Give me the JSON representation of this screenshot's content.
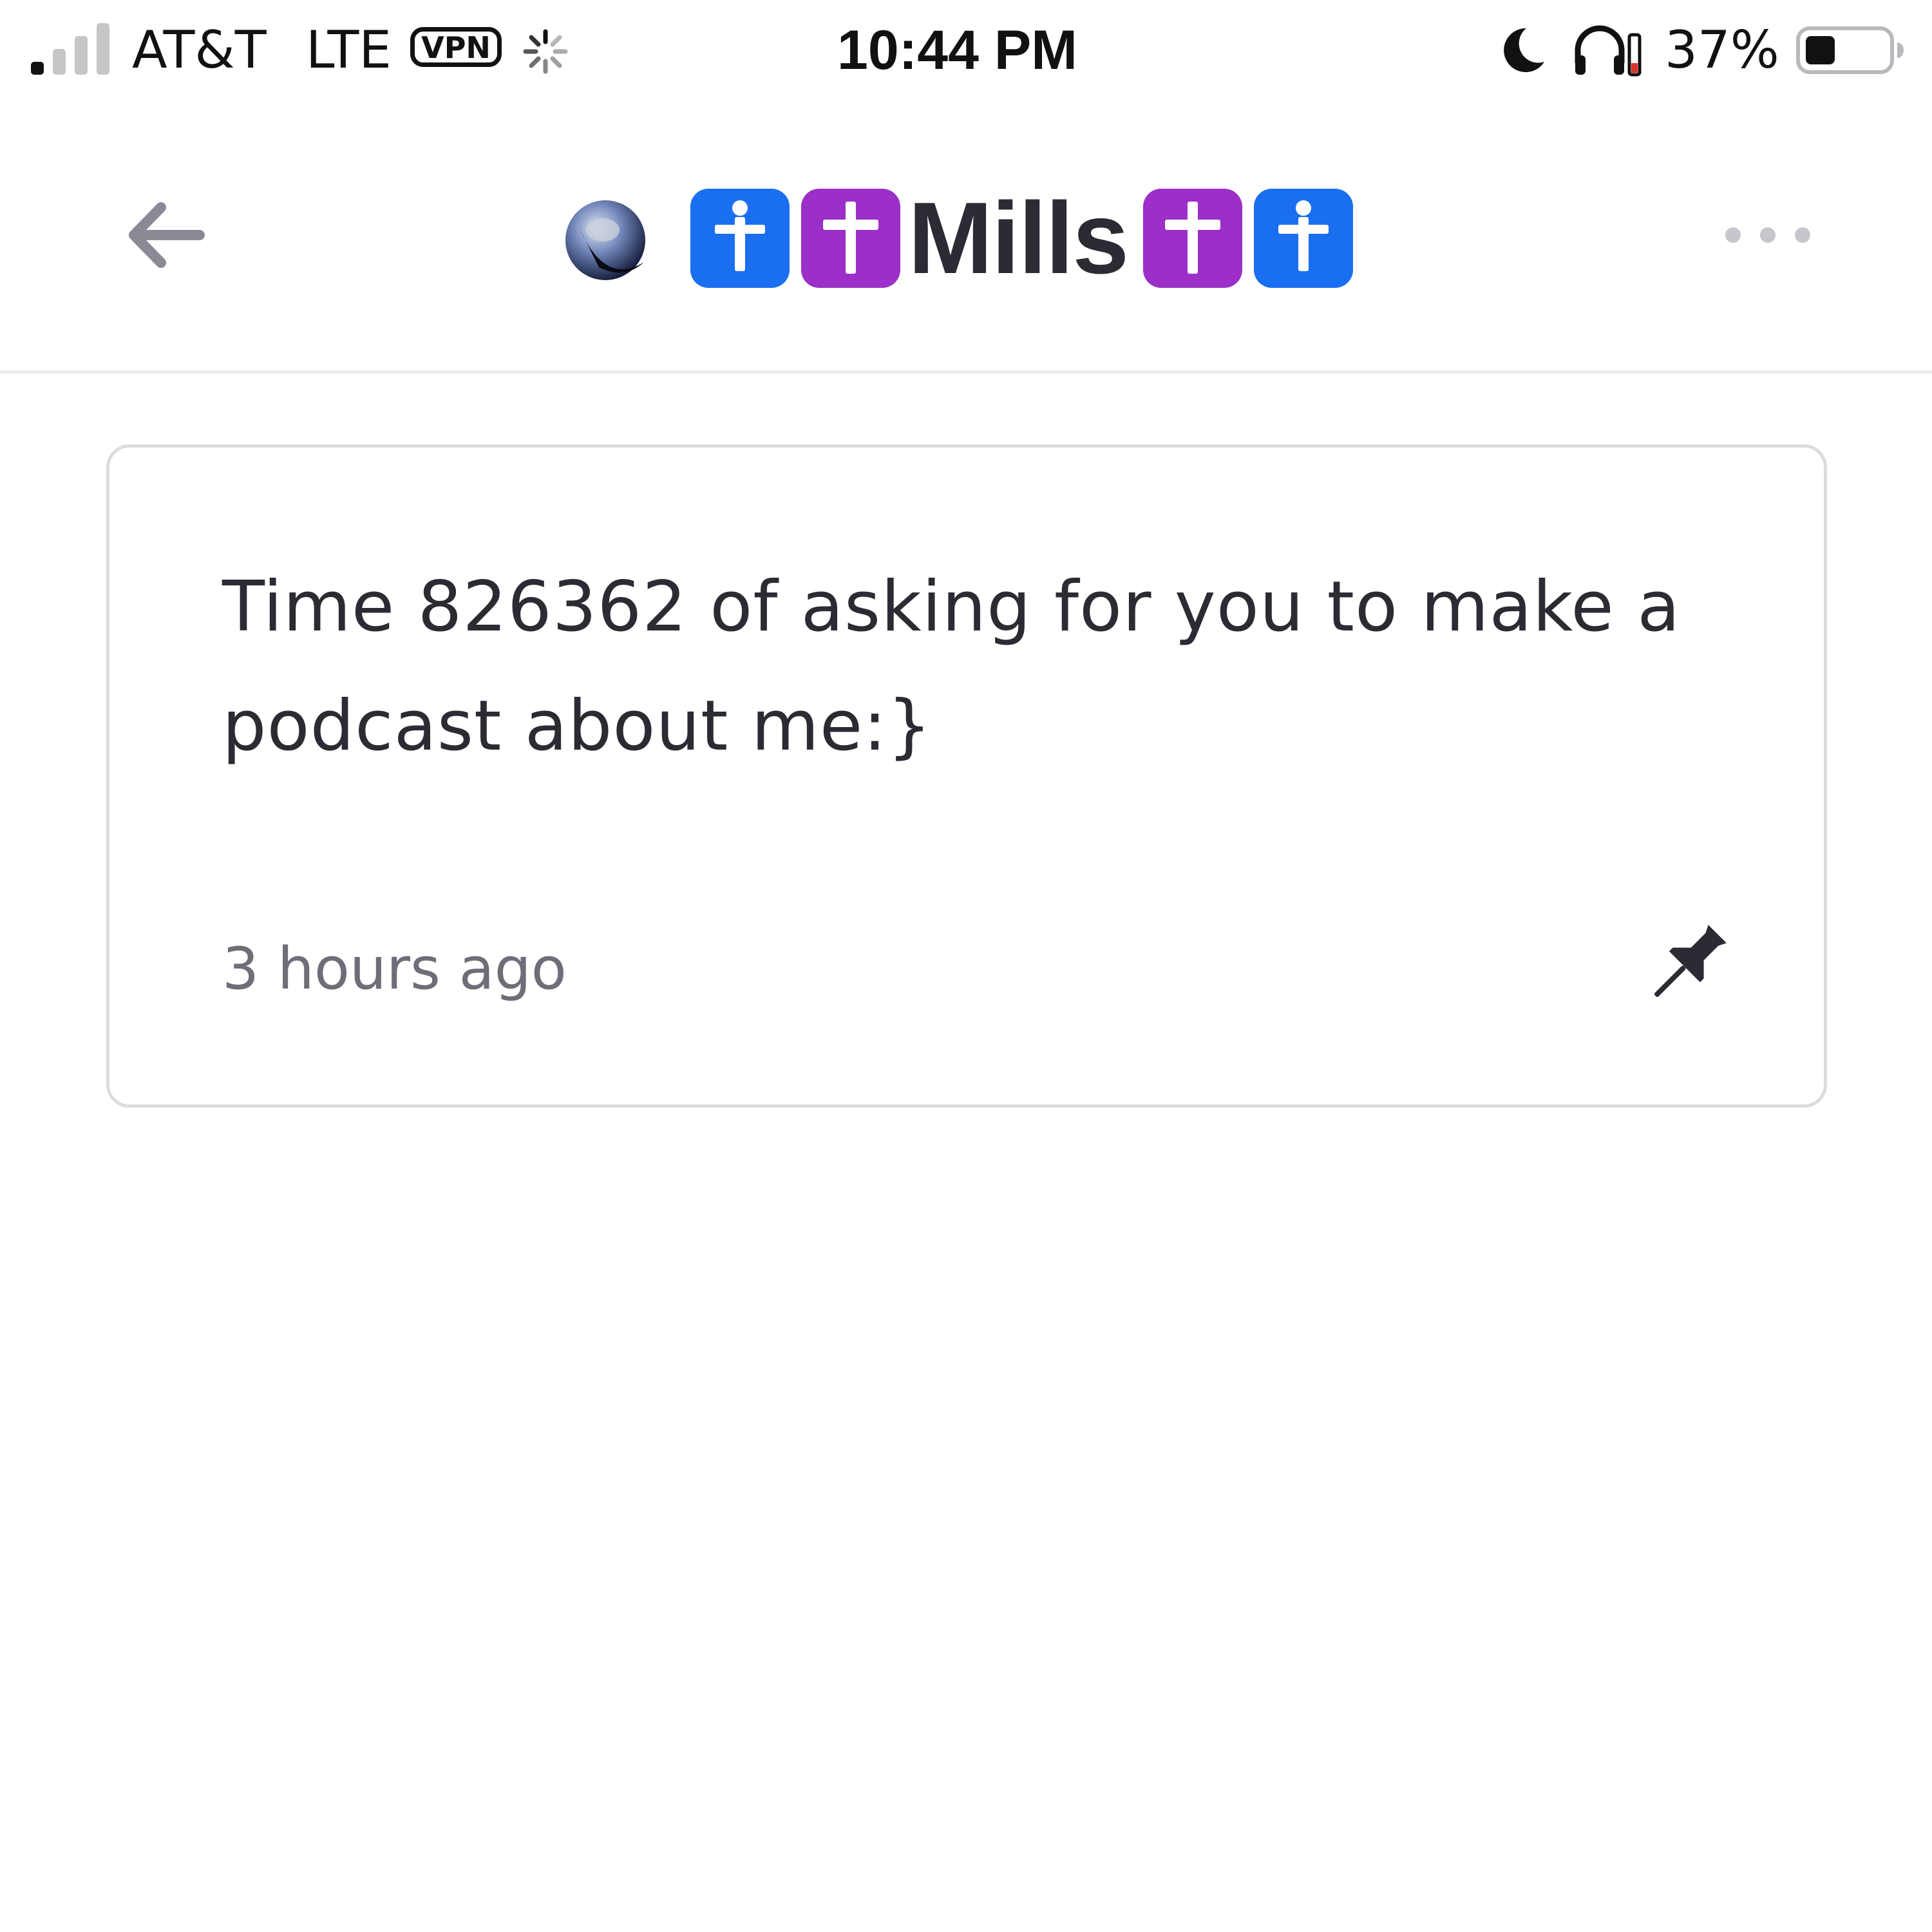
{
  "status_bar": {
    "signal_bars_active": 1,
    "signal_bars_total": 4,
    "carrier": "AT&T",
    "network": "LTE",
    "vpn_label": "VPN",
    "time": "10:44 PM",
    "battery_percent": "37%",
    "battery_level": 0.37,
    "icons": [
      "loading-spinner-icon",
      "moon-icon",
      "headphones-icon",
      "battery-icon"
    ]
  },
  "nav": {
    "back_icon": "arrow-left-icon",
    "avatar_icon": "avatar-icon",
    "title_name": "Mills",
    "badge_icons": [
      "person-badge-icon",
      "cross-badge-icon",
      "cross-badge-icon",
      "person-badge-icon"
    ],
    "more_icon": "ellipsis-icon"
  },
  "message": {
    "text": "Time 826362 of asking for you to make a podcast about me:}",
    "timestamp": "3 hours ago",
    "pin_icon": "pin-icon"
  },
  "colors": {
    "badge_blue": "#1a6ff0",
    "badge_purple": "#9b2fc7",
    "card_border": "#dcdce0",
    "muted_text": "#6e6e78",
    "icon_gray": "#8a8a94"
  }
}
